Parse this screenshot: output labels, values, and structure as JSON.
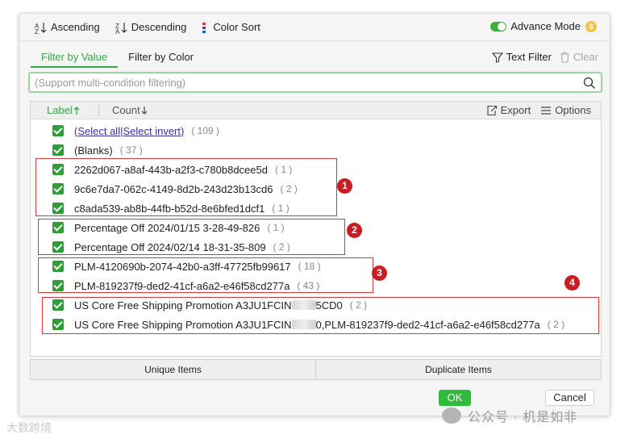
{
  "toolbar": {
    "ascending": "Ascending",
    "descending": "Descending",
    "color_sort": "Color Sort",
    "advance_mode": "Advance Mode",
    "advance_mode_on": true
  },
  "tabs": {
    "by_value": "Filter by Value",
    "by_color": "Filter by Color",
    "active": "Filter by Value"
  },
  "tools": {
    "text_filter": "Text Filter",
    "clear": "Clear"
  },
  "search": {
    "placeholder": "(Support multi-condition filtering)",
    "value": ""
  },
  "list_header": {
    "label": "Label",
    "count": "Count",
    "export": "Export",
    "options": "Options"
  },
  "items": [
    {
      "select_all": "(Select all",
      "select_invert": "Select invert)",
      "count": "( 109 )",
      "checked": true
    },
    {
      "label": "(Blanks)",
      "count": "( 37 )",
      "checked": true
    },
    {
      "label": "2262d067-a8af-443b-a2f3-c780b8dcee5d",
      "count": "( 1 )",
      "checked": true
    },
    {
      "label": "9c6e7da7-062c-4149-8d2b-243d23b13cd6",
      "count": "( 2 )",
      "checked": true
    },
    {
      "label": "c8ada539-ab8b-44fb-b52d-8e6bfed1dcf1",
      "count": "( 1 )",
      "checked": true
    },
    {
      "label": "Percentage Off 2024/01/15 3-28-49-826",
      "count": "( 1 )",
      "checked": true
    },
    {
      "label": "Percentage Off 2024/02/14 18-31-35-809",
      "count": "( 2 )",
      "checked": true
    },
    {
      "label": "PLM-4120690b-2074-42b0-a3ff-47725fb99617",
      "count": "( 18 )",
      "checked": true
    },
    {
      "label": "PLM-819237f9-ded2-41cf-a6a2-e46f58cd277a",
      "count": "( 43 )",
      "checked": true
    },
    {
      "label_prefix": "US Core Free Shipping Promotion A3JU1FCIN",
      "label_suffix": "5CD0",
      "count": "( 2 )",
      "checked": true
    },
    {
      "label_prefix": "US Core Free Shipping Promotion A3JU1FCIN",
      "label_suffix": "0,PLM-819237f9-ded2-41cf-a6a2-e46f58cd277a",
      "count": "( 2 )",
      "checked": true
    }
  ],
  "bottom_tabs": {
    "unique": "Unique Items",
    "duplicate": "Duplicate Items"
  },
  "buttons": {
    "ok": "OK",
    "cancel": "Cancel"
  },
  "annotations": [
    "1",
    "2",
    "3",
    "4"
  ],
  "watermark": {
    "right": "公众号 · 机是如非",
    "left": "大数跨境"
  },
  "colors": {
    "accent_green": "#3aa64a",
    "checkbox_green": "#2f9e36",
    "annotation_red": "#d9383f",
    "badge_red": "#c71d23"
  }
}
